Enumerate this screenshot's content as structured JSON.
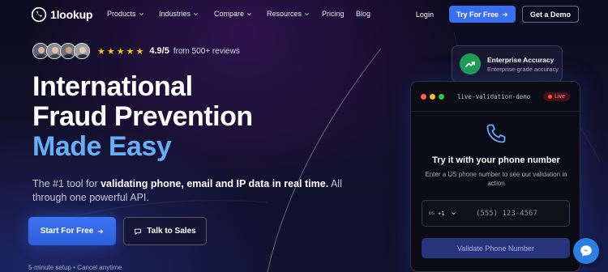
{
  "nav": {
    "logo_text": "1lookup",
    "links": [
      {
        "label": "Products",
        "dropdown": true
      },
      {
        "label": "Industries",
        "dropdown": true
      },
      {
        "label": "Compare",
        "dropdown": true
      },
      {
        "label": "Resources",
        "dropdown": true
      },
      {
        "label": "Pricing",
        "dropdown": false
      },
      {
        "label": "Blog",
        "dropdown": false
      }
    ],
    "login": "Login",
    "try_label": "Try For Free",
    "demo_label": "Get a Demo"
  },
  "rating": {
    "stars": 5,
    "star_glyph": "★",
    "score": "4.9/5",
    "reviews": "from 500+ reviews"
  },
  "hero": {
    "line1": "International",
    "line2": "Fraud Prevention",
    "line3": "Made Easy",
    "sub_prefix": "The #1 tool for ",
    "sub_bold": "validating phone, email and IP data in real time.",
    "sub_suffix": " All through one powerful API.",
    "start_label": "Start For Free",
    "sales_label": "Talk to Sales",
    "footnote": "5-minute setup • Cancel anytime"
  },
  "badge": {
    "title": "Enterprise Accuracy",
    "subtitle": "Enterprise-grade accuracy"
  },
  "demo": {
    "window_title": "live-validation-demo",
    "live": "Live",
    "heading": "Try it with your phone number",
    "description": "Enter a US phone number to see our validation in action",
    "country_flag": "us",
    "country_code": "+1",
    "placeholder": "(555) 123-4567",
    "button": "Validate Phone Number"
  },
  "colors": {
    "accent": "#3a6ff0",
    "headline_blue": "#67aef7",
    "star": "#f5c518",
    "badge_green": "#1f9d55",
    "dot_red": "#ff5f57",
    "dot_yellow": "#febc2e",
    "dot_green": "#28c840"
  },
  "icons": [
    "phone-logo-icon",
    "chevron-down-icon",
    "arrow-right-icon",
    "star-icon",
    "chat-bubble-icon",
    "trend-up-icon",
    "phone-icon",
    "messenger-icon"
  ]
}
